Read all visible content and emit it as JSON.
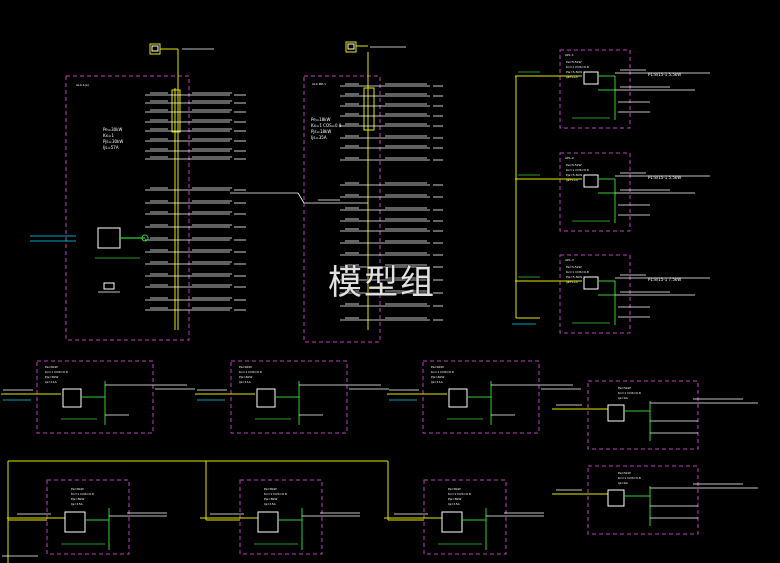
{
  "watermark": "模型组",
  "colors": {
    "background": "#000000",
    "panel_border": "#c040c0",
    "feeder": "#e6e600",
    "branch": "#ffffff",
    "component": "#33cc33",
    "text": "#ffffff",
    "accent_cyan": "#00d8ff"
  },
  "panels": {
    "main_a": {
      "id": "AL4-1(a)"
    },
    "main_b": {
      "id": "AL4-MP-1"
    },
    "right_1": {
      "id": "AP1-1",
      "rating": "P1:8/15-1 5.5kW"
    },
    "right_2": {
      "id": "AP1-2",
      "rating": "P1:8/15-1 5.5kW"
    },
    "right_3": {
      "id": "AP1-3",
      "rating": "P1:8/15-1 7.5kW"
    }
  },
  "load_block": {
    "pe": "Pe=30kW",
    "kx": "Kx=1",
    "cos": "COS Φ=0.8",
    "pjs": "Pjs=30kW",
    "ijs": "Ijs=57A"
  }
}
